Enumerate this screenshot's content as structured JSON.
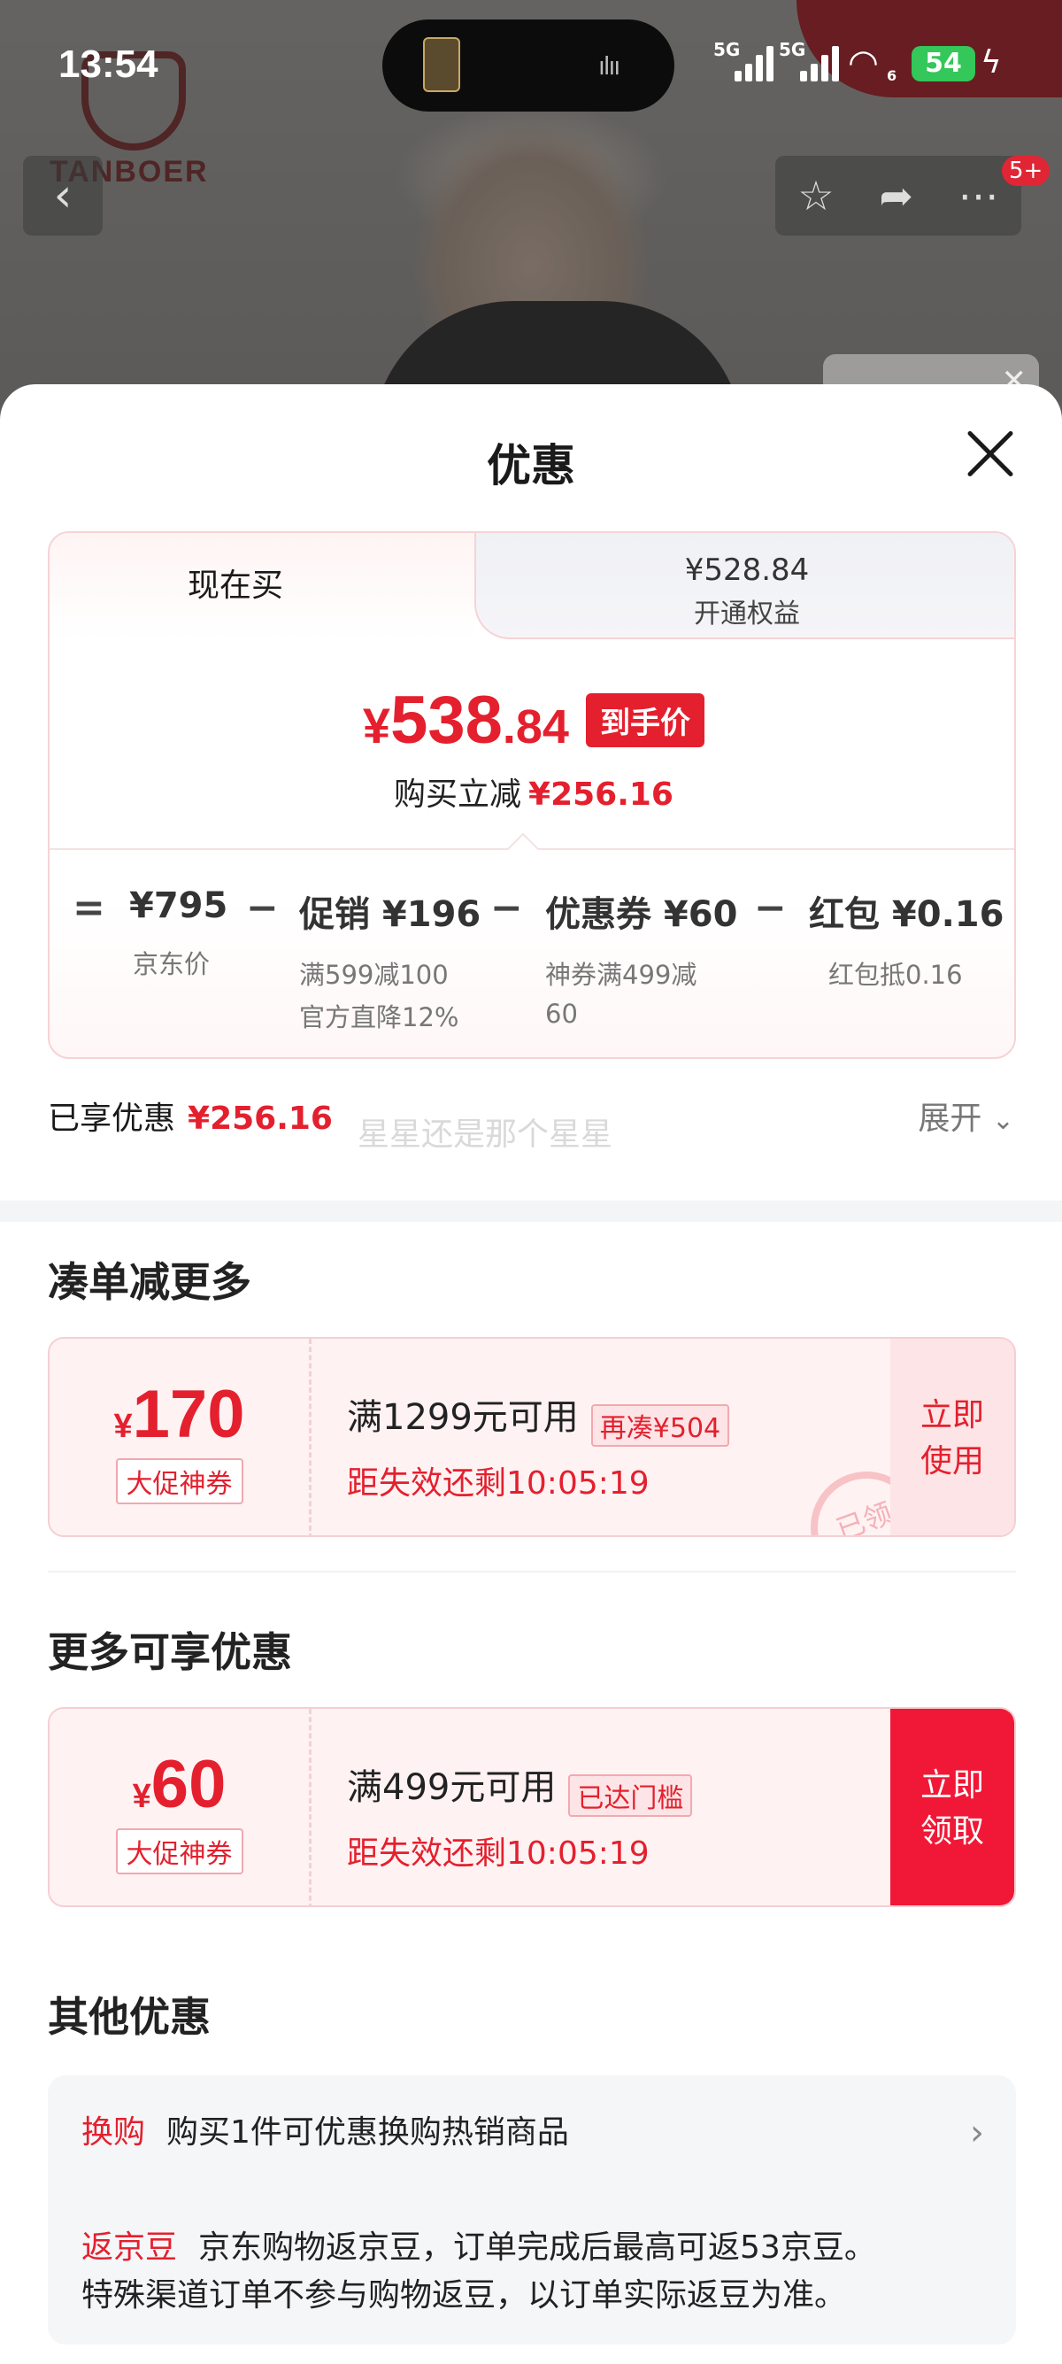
{
  "status_bar": {
    "time": "13:54",
    "sim1": "5G",
    "sim2": "5G",
    "wifi_sub": "6",
    "battery": "54"
  },
  "background": {
    "brand": "TANBOER",
    "cart_badge": "5+"
  },
  "sheet": {
    "title": "优惠"
  },
  "tabs": {
    "active_label": "现在买",
    "member_price": "¥528.84",
    "member_label": "开通权益"
  },
  "final": {
    "yen": "¥",
    "integer": "538",
    "decimal": ".84",
    "tag": "到手价",
    "instant_label": "购买立减",
    "instant_value": "¥256.16"
  },
  "formula": {
    "equals": "=",
    "minus": "−",
    "items": [
      {
        "head": "¥795",
        "sub1": "京东价",
        "sub2": ""
      },
      {
        "head": "促销 ¥196",
        "sub1": "满599减100",
        "sub2": "官方直降12%"
      },
      {
        "head": "优惠券 ¥60",
        "sub1": "神券满499减",
        "sub2": "60"
      },
      {
        "head": "红包 ¥0.16",
        "sub1": "红包抵0.16",
        "sub2": ""
      }
    ]
  },
  "enjoyed": {
    "label": "已享优惠",
    "value": "¥256.16",
    "watermark": "星星还是那个星星",
    "expand": "展开"
  },
  "section_more": {
    "title": "凑单减更多",
    "coupon": {
      "yen": "¥",
      "amount": "170",
      "type": "大促神券",
      "condition": "满1299元可用",
      "tag": "再凑¥504",
      "timer": "距失效还剩10:05:19",
      "cta_line1": "立即",
      "cta_line2": "使用",
      "stamp": "已领"
    }
  },
  "section_available": {
    "title": "更多可享优惠",
    "coupon": {
      "yen": "¥",
      "amount": "60",
      "type": "大促神券",
      "condition": "满499元可用",
      "tag": "已达门槛",
      "timer": "距失效还剩10:05:19",
      "cta_line1": "立即",
      "cta_line2": "领取"
    }
  },
  "section_other": {
    "title": "其他优惠",
    "row1_label": "换购",
    "row1_text": "购买1件可优惠换购热销商品",
    "row2_label": "返京豆",
    "row2_text": "京东购物返京豆，订单完成后最高可返53京豆。",
    "row2_text2": "特殊渠道订单不参与购物返豆，以订单实际返豆为准。"
  },
  "colors": {
    "accent_red": "#e4202e",
    "cta_red": "#f01836",
    "coupon_bg": "#fff2f3"
  }
}
